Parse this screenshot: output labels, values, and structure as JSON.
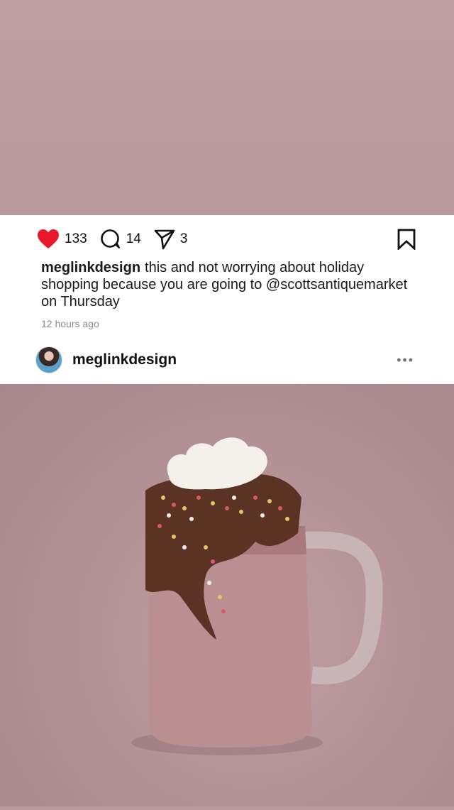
{
  "post": {
    "likes": "133",
    "comments": "14",
    "shares": "3",
    "caption_user": "meglinkdesign",
    "caption_text": "this and not worrying about holiday shopping because you are going to @scottsantiquemarket on Thursday",
    "timestamp": "12 hours ago",
    "author": "meglinkdesign",
    "more_label": "•••"
  },
  "icons": {
    "like": "heart-icon",
    "comment": "comment-icon",
    "share": "send-icon",
    "save": "bookmark-icon",
    "more": "more-icon"
  },
  "colors": {
    "heart": "#e8192c",
    "photo_background": "#b89a9c",
    "card": "#ffffff"
  }
}
